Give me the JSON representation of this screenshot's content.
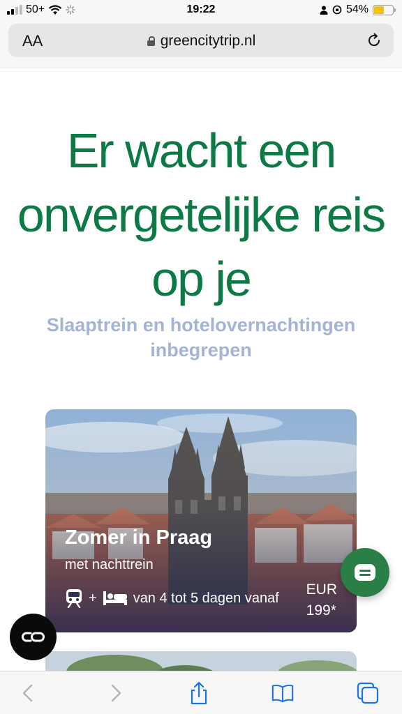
{
  "status_bar": {
    "carrier": "50+",
    "time": "19:22",
    "battery": "54%"
  },
  "browser": {
    "text_size_label": "AA",
    "url": "greencitytrip.nl"
  },
  "hero": {
    "title": "Er wacht een onvergetelijke reis op je",
    "subtitle": "Slaaptrein en hotelovernachtingen inbegrepen"
  },
  "card": {
    "title": "Zomer in Praag",
    "subtitle": "met nachttrein",
    "plus": "+",
    "duration": "van 4 tot 5 dagen vanaf",
    "currency": "EUR",
    "price": "199*"
  },
  "colors": {
    "brand_green": "#0c7a45",
    "subtitle_blue": "#a5b4d6",
    "chat_green": "#2a7f46"
  },
  "icons": [
    "signal-icon",
    "wifi-icon",
    "loading-icon",
    "person-icon",
    "orientation-lock-icon",
    "battery-icon",
    "lock-icon",
    "reload-icon",
    "train-icon",
    "bed-icon",
    "chat-icon",
    "cookie-icon",
    "back-icon",
    "forward-icon",
    "share-icon",
    "bookmarks-icon",
    "tabs-icon"
  ]
}
